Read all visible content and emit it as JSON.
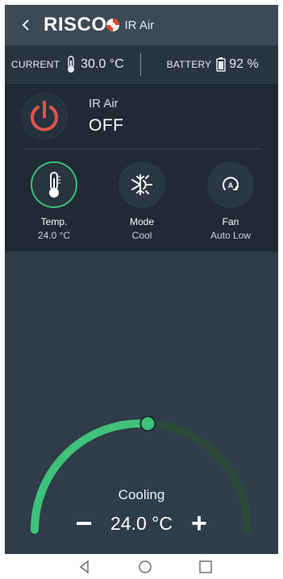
{
  "header": {
    "brand": "RISCO",
    "title": "IR Air",
    "back_icon": "chevron-left-icon",
    "logo_icon": "risco-swirl-icon"
  },
  "status": {
    "current_label": "CURRENT",
    "current_value": "30.0 °C",
    "current_icon": "thermometer-icon",
    "battery_label": "BATTERY",
    "battery_value": "92 %",
    "battery_icon": "battery-icon"
  },
  "device": {
    "name": "IR Air",
    "state": "OFF",
    "power_icon": "power-icon",
    "power_color": "#e0554d"
  },
  "controls": [
    {
      "label": "Temp.",
      "value": "24.0 °C",
      "icon": "thermometer-icon"
    },
    {
      "label": "Mode",
      "value": "Cool",
      "icon": "snowflake-sun-icon"
    },
    {
      "label": "Fan",
      "value": "Auto Low",
      "icon": "fan-auto-icon"
    }
  ],
  "dial": {
    "mode": "Cooling",
    "temperature": "24.0 °C",
    "minus_label": "−",
    "plus_label": "+",
    "level": 0.52,
    "accent_color": "#3fc27a",
    "track_color": "#2a4a3a"
  },
  "navbar": {
    "back_icon": "triangle-back-icon",
    "home_icon": "circle-home-icon",
    "recents_icon": "square-recents-icon"
  }
}
